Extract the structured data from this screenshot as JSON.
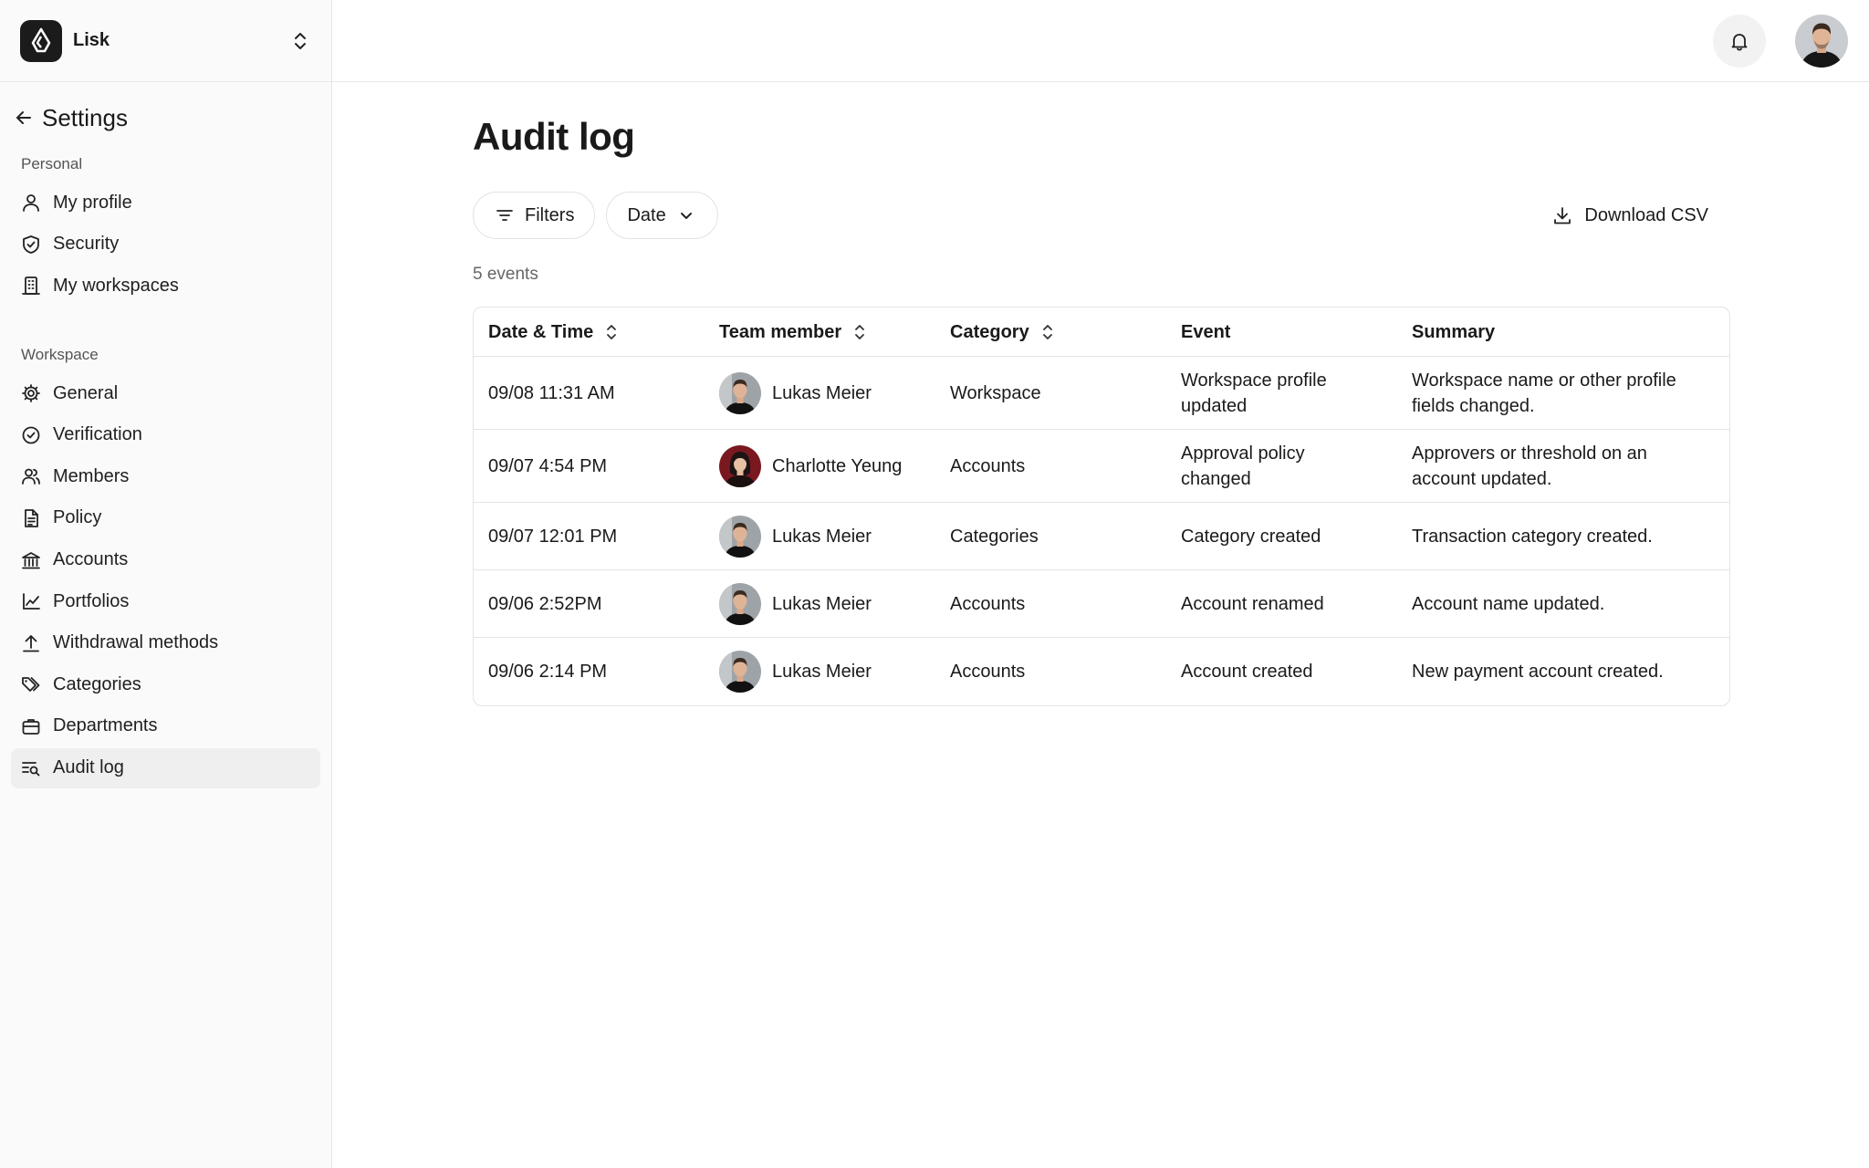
{
  "workspace": {
    "name": "Lisk"
  },
  "sidebar": {
    "back_title": "Settings",
    "personal_label": "Personal",
    "personal_items": [
      {
        "label": "My profile",
        "icon": "user-icon"
      },
      {
        "label": "Security",
        "icon": "shield-icon"
      },
      {
        "label": "My workspaces",
        "icon": "building-icon"
      }
    ],
    "workspace_label": "Workspace",
    "workspace_items": [
      {
        "label": "General",
        "icon": "gear-icon"
      },
      {
        "label": "Verification",
        "icon": "check-circle-icon"
      },
      {
        "label": "Members",
        "icon": "users-icon"
      },
      {
        "label": "Policy",
        "icon": "document-icon"
      },
      {
        "label": "Accounts",
        "icon": "bank-icon"
      },
      {
        "label": "Portfolios",
        "icon": "chart-line-icon"
      },
      {
        "label": "Withdrawal methods",
        "icon": "upload-icon"
      },
      {
        "label": "Categories",
        "icon": "tags-icon"
      },
      {
        "label": "Departments",
        "icon": "briefcase-icon"
      },
      {
        "label": "Audit log",
        "icon": "audit-log-icon",
        "active": true
      }
    ]
  },
  "page": {
    "title": "Audit log",
    "filters_label": "Filters",
    "date_label": "Date",
    "download_label": "Download CSV",
    "count_text": "5 events"
  },
  "table": {
    "headers": [
      "Date & Time",
      "Team member",
      "Category",
      "Event",
      "Summary"
    ],
    "rows": [
      {
        "datetime": "09/08 11:31 AM",
        "member": "Lukas Meier",
        "avatar": "male",
        "category": "Workspace",
        "event": "Workspace profile updated",
        "summary": "Workspace name or other profile fields changed."
      },
      {
        "datetime": "09/07 4:54 PM",
        "member": "Charlotte Yeung",
        "avatar": "female",
        "category": "Accounts",
        "event": "Approval policy changed",
        "summary": "Approvers or threshold on an account updated."
      },
      {
        "datetime": "09/07 12:01 PM",
        "member": "Lukas Meier",
        "avatar": "male",
        "category": "Categories",
        "event": "Category created",
        "summary": "Transaction category created."
      },
      {
        "datetime": "09/06 2:52PM",
        "member": "Lukas Meier",
        "avatar": "male",
        "category": "Accounts",
        "event": "Account renamed",
        "summary": "Account name updated."
      },
      {
        "datetime": "09/06 2:14 PM",
        "member": "Lukas Meier",
        "avatar": "male",
        "category": "Accounts",
        "event": "Account created",
        "summary": "New payment account created."
      }
    ]
  },
  "colors": {
    "sidebar_bg": "#fafafa",
    "active_bg": "#efefef",
    "border": "#e4e4e4",
    "text": "#1a1a1a"
  }
}
